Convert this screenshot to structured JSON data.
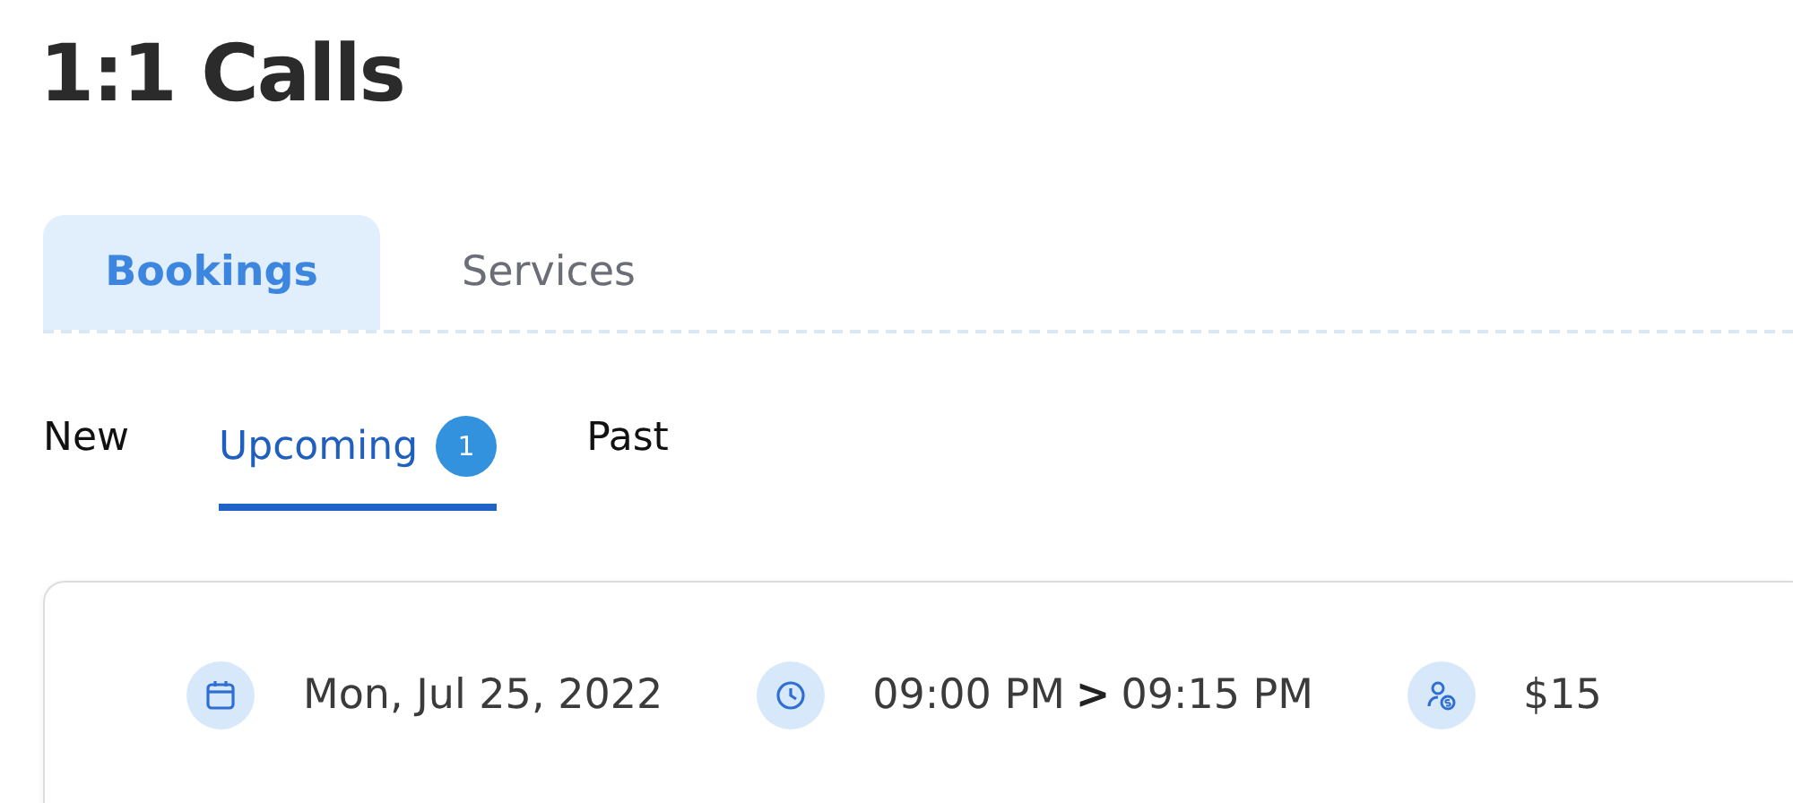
{
  "title": "1:1 Calls",
  "tabs": [
    {
      "label": "Bookings",
      "selected": true
    },
    {
      "label": "Services",
      "selected": false
    }
  ],
  "subtabs": [
    {
      "label": "New",
      "selected": false
    },
    {
      "label": "Upcoming",
      "selected": true,
      "badge": "1"
    },
    {
      "label": "Past",
      "selected": false
    }
  ],
  "booking": {
    "date": "Mon, Jul 25, 2022",
    "start_time": "09:00 PM",
    "separator": ">",
    "end_time": "09:15 PM",
    "price": "$15"
  }
}
